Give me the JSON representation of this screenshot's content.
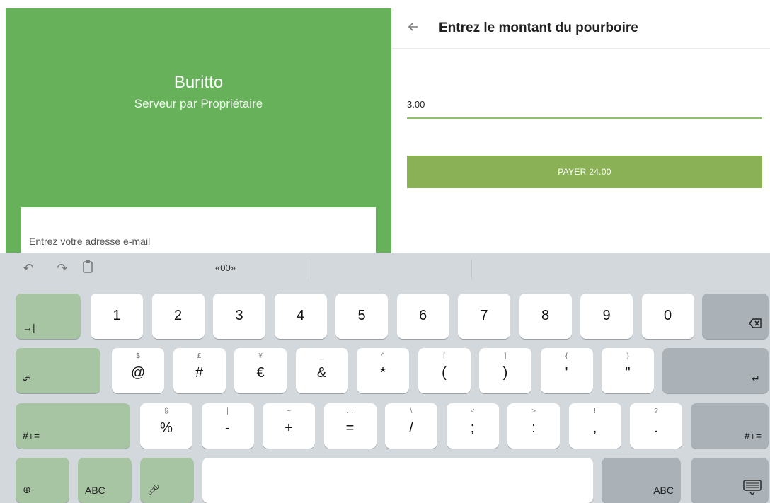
{
  "left": {
    "brand_title": "Buritto",
    "brand_subtitle": "Serveur par Propriétaire",
    "email_label": "Entrez votre adresse e-mail"
  },
  "right": {
    "title": "Entrez le montant du pourboire",
    "tip_value": "3.00",
    "pay_label": "PAYER 24.00"
  },
  "keyboard": {
    "suggestion": "«00»",
    "row1": [
      "1",
      "2",
      "3",
      "4",
      "5",
      "6",
      "7",
      "8",
      "9",
      "0"
    ],
    "tab_label": "→|",
    "row2": [
      {
        "alt": "$",
        "main": "@"
      },
      {
        "alt": "£",
        "main": "#"
      },
      {
        "alt": "¥",
        "main": "€"
      },
      {
        "alt": "_",
        "main": "&"
      },
      {
        "alt": "^",
        "main": "*"
      },
      {
        "alt": "[",
        "main": "("
      },
      {
        "alt": "]",
        "main": ")"
      },
      {
        "alt": "{",
        "main": "'"
      },
      {
        "alt": "}",
        "main": "\""
      }
    ],
    "row3": [
      {
        "alt": "§",
        "main": "%"
      },
      {
        "alt": "|",
        "main": "-"
      },
      {
        "alt": "~",
        "main": "+"
      },
      {
        "alt": "…",
        "main": "="
      },
      {
        "alt": "\\",
        "main": "/"
      },
      {
        "alt": "<",
        "main": ";"
      },
      {
        "alt": ">",
        "main": ":"
      },
      {
        "alt": "!",
        "main": ","
      },
      {
        "alt": "?",
        "main": "."
      }
    ],
    "shift_symbols_left": "#+=",
    "shift_symbols_right": "#+=",
    "abc_left": "ABC",
    "abc_right": "ABC"
  }
}
